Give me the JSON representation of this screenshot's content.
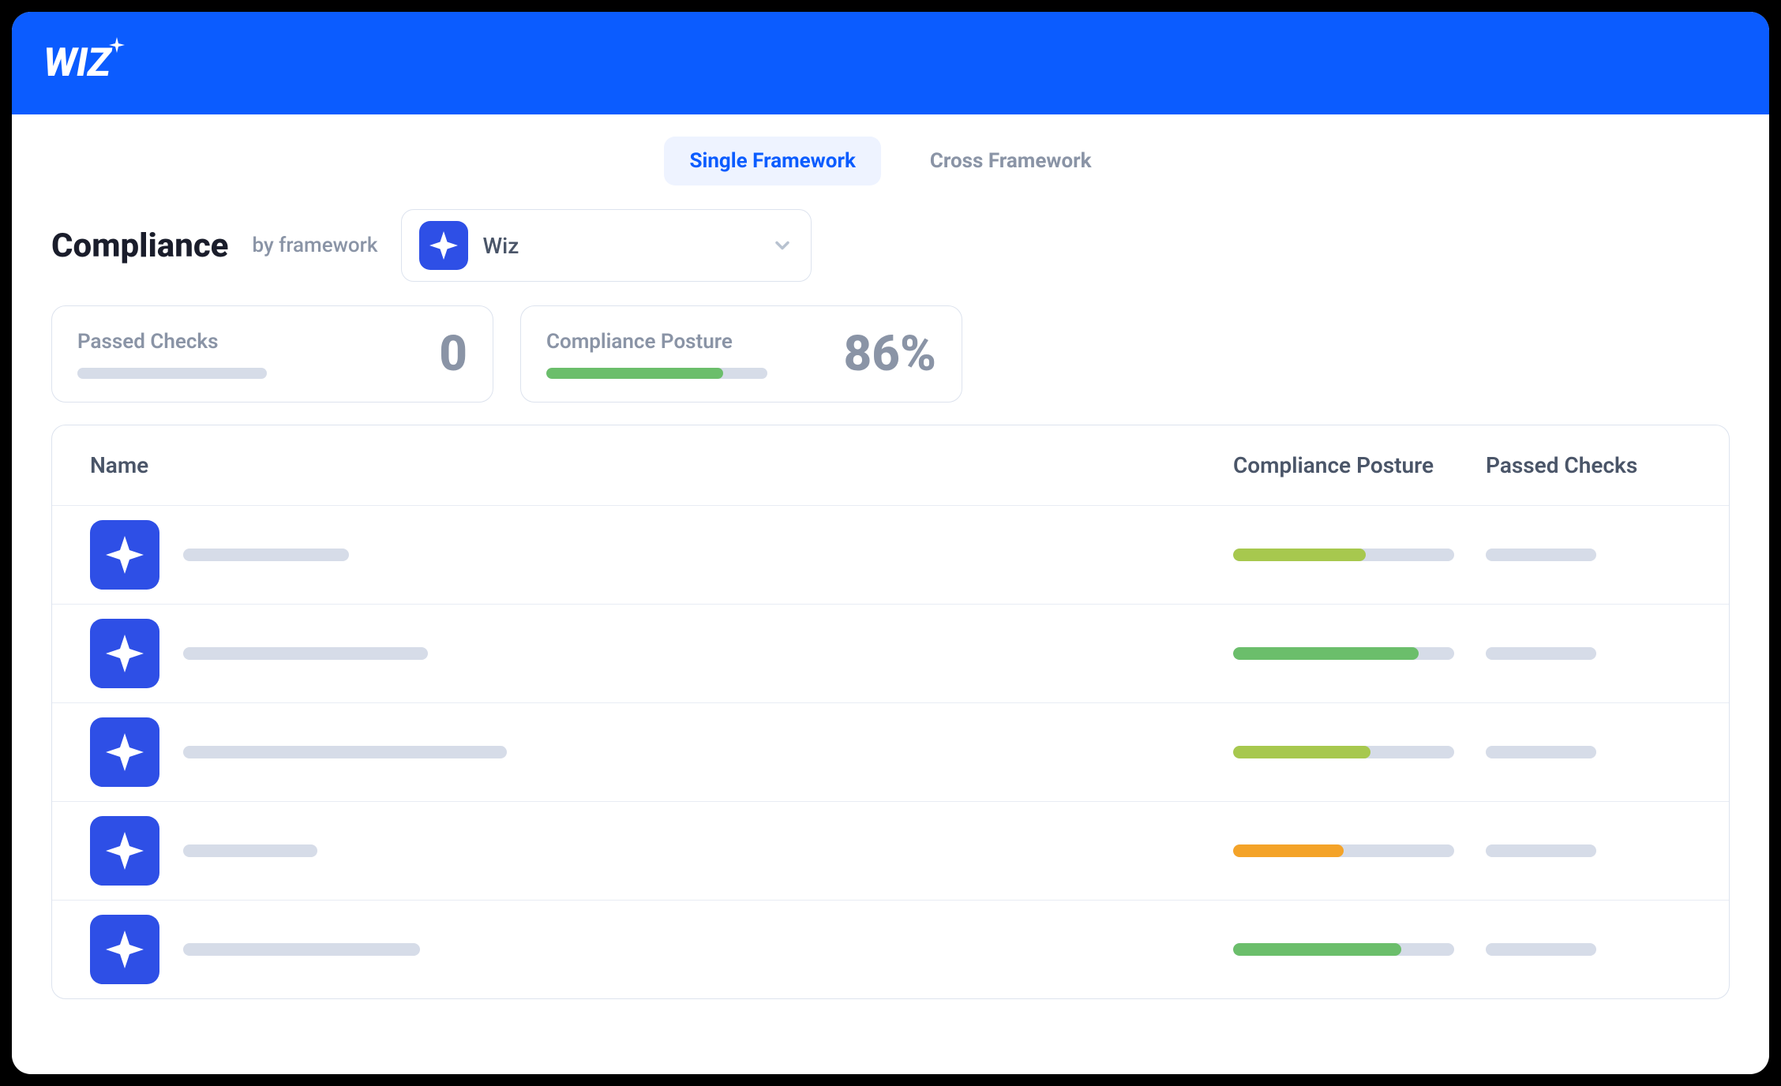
{
  "brand": "WIZ",
  "tabs": {
    "single": "Single Framework",
    "cross": "Cross Framework",
    "active": "single"
  },
  "header": {
    "title": "Compliance",
    "subtitle": "by framework"
  },
  "frameworkSelect": {
    "value": "Wiz"
  },
  "cards": {
    "passed": {
      "label": "Passed Checks",
      "value": "0",
      "fillPercent": 0
    },
    "posture": {
      "label": "Compliance Posture",
      "value": "86%",
      "fillPercent": 80,
      "fillColor": "#6BBE6B"
    }
  },
  "table": {
    "columns": {
      "name": "Name",
      "posture": "Compliance Posture",
      "passed": "Passed Checks"
    },
    "rows": [
      {
        "nameWidth": 210,
        "posturePercent": 60,
        "postureColor": "#A7C84E"
      },
      {
        "nameWidth": 310,
        "posturePercent": 84,
        "postureColor": "#6BBE6B"
      },
      {
        "nameWidth": 410,
        "posturePercent": 62,
        "postureColor": "#A7C84E"
      },
      {
        "nameWidth": 170,
        "posturePercent": 50,
        "postureColor": "#F4A328"
      },
      {
        "nameWidth": 300,
        "posturePercent": 76,
        "postureColor": "#6BBE6B"
      }
    ]
  },
  "colors": {
    "brand": "#0B5CFF",
    "iconBg": "#2E4FE6",
    "placeholder": "#D6DCE8"
  }
}
